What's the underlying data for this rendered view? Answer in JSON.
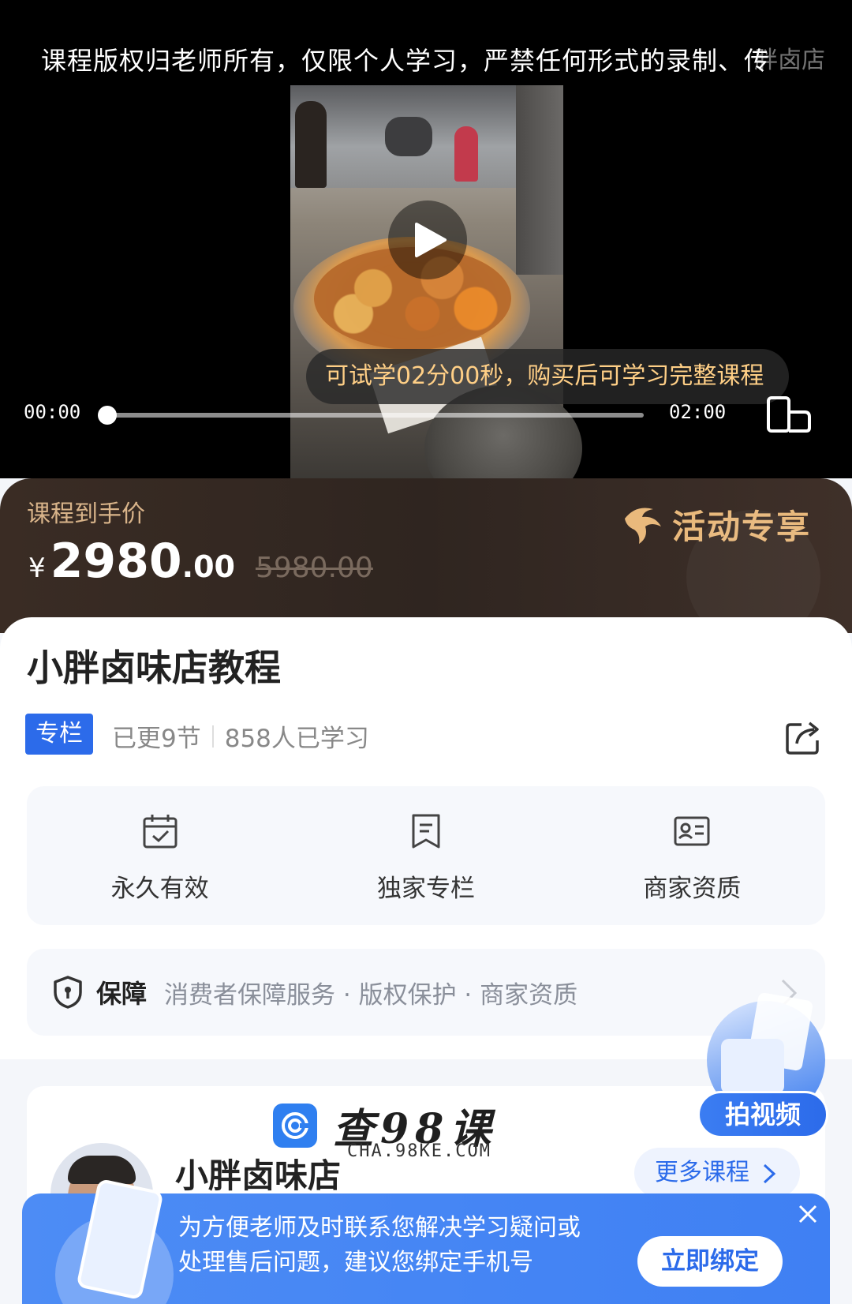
{
  "video": {
    "copyright_notice": "课程版权归老师所有，仅限个人学习，严禁任何形式的录制、传",
    "copyright_ghost": "胖卤店",
    "trial_notice": "可试学02分00秒，购买后可学习完整课程",
    "current_time": "00:00",
    "total_time": "02:00",
    "progress": 0
  },
  "price": {
    "label": "课程到手价",
    "currency": "¥",
    "current_int": "2980",
    "current_dec": ".00",
    "original": "5980.00",
    "promo_label": "活动专享"
  },
  "course": {
    "title": "小胖卤味店教程",
    "tag": "专栏",
    "updated": "已更9节",
    "learners": "858人已学习"
  },
  "features": [
    {
      "label": "永久有效",
      "icon": "calendar-check-icon"
    },
    {
      "label": "独家专栏",
      "icon": "bookmark-doc-icon"
    },
    {
      "label": "商家资质",
      "icon": "id-card-icon"
    }
  ],
  "guarantee": {
    "title": "保障",
    "items": "消费者保障服务 · 版权保护 · 商家资质"
  },
  "teacher": {
    "name": "小胖卤味店",
    "more_courses": "更多课程"
  },
  "watermark": {
    "title": "查98课",
    "domain": "CHA.98KE.COM"
  },
  "float_button": {
    "label": "拍视频"
  },
  "bind_phone": {
    "line1": "为方便老师及时联系您解决学习疑问或",
    "line2": "处理售后问题，建议您绑定手机号",
    "button": "立即绑定"
  },
  "colors": {
    "accent": "#2c6bea",
    "price_banner": "#2f2520",
    "promo_gold": "#e9b97c",
    "trial_text": "#ffcf86"
  }
}
